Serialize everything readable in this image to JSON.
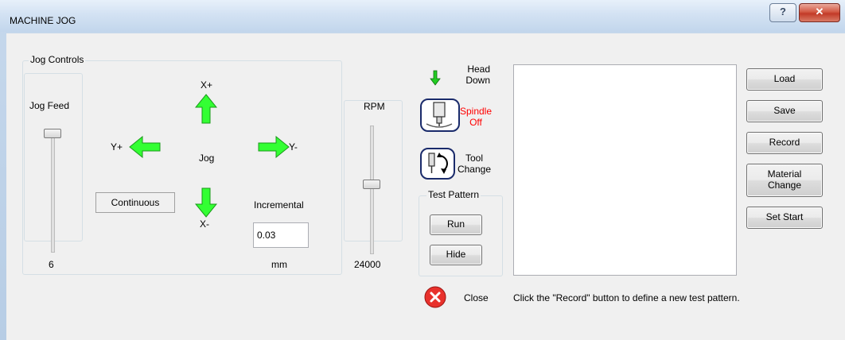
{
  "window": {
    "title": "MACHINE JOG",
    "help_glyph": "?",
    "close_glyph": "✕"
  },
  "jog_controls": {
    "group_label": "Jog Controls",
    "jog_feed_label": "Jog Feed",
    "jog_feed_value": "6",
    "center_label": "Jog",
    "x_plus": "X+",
    "x_minus": "X-",
    "y_plus": "Y+",
    "y_minus": "Y-",
    "continuous_label": "Continuous",
    "incremental_label": "Incremental",
    "incremental_value": "0.03",
    "incremental_unit": "mm"
  },
  "rpm": {
    "label": "RPM",
    "value": "24000"
  },
  "head_down_label": "Head\nDown",
  "spindle_label": "Spindle\nOff",
  "tool_change_label": "Tool\nChange",
  "test_pattern": {
    "group_label": "Test Pattern",
    "run_label": "Run",
    "hide_label": "Hide"
  },
  "close_label": "Close",
  "buttons": {
    "load": "Load",
    "save": "Save",
    "record": "Record",
    "material_change": "Material\nChange",
    "set_start": "Set Start"
  },
  "status_text": "Click the \"Record\" button to define a new test pattern.",
  "colors": {
    "arrow_green": "#33ff33",
    "spindle_red": "#ff0000",
    "close_red": "#e8312c"
  },
  "icons": [
    "help-icon",
    "close-icon",
    "head-down-arrow-icon",
    "spindle-icon",
    "tool-change-icon",
    "close-circle-icon",
    "arrow-up-icon",
    "arrow-down-icon",
    "arrow-left-icon",
    "arrow-right-icon"
  ]
}
